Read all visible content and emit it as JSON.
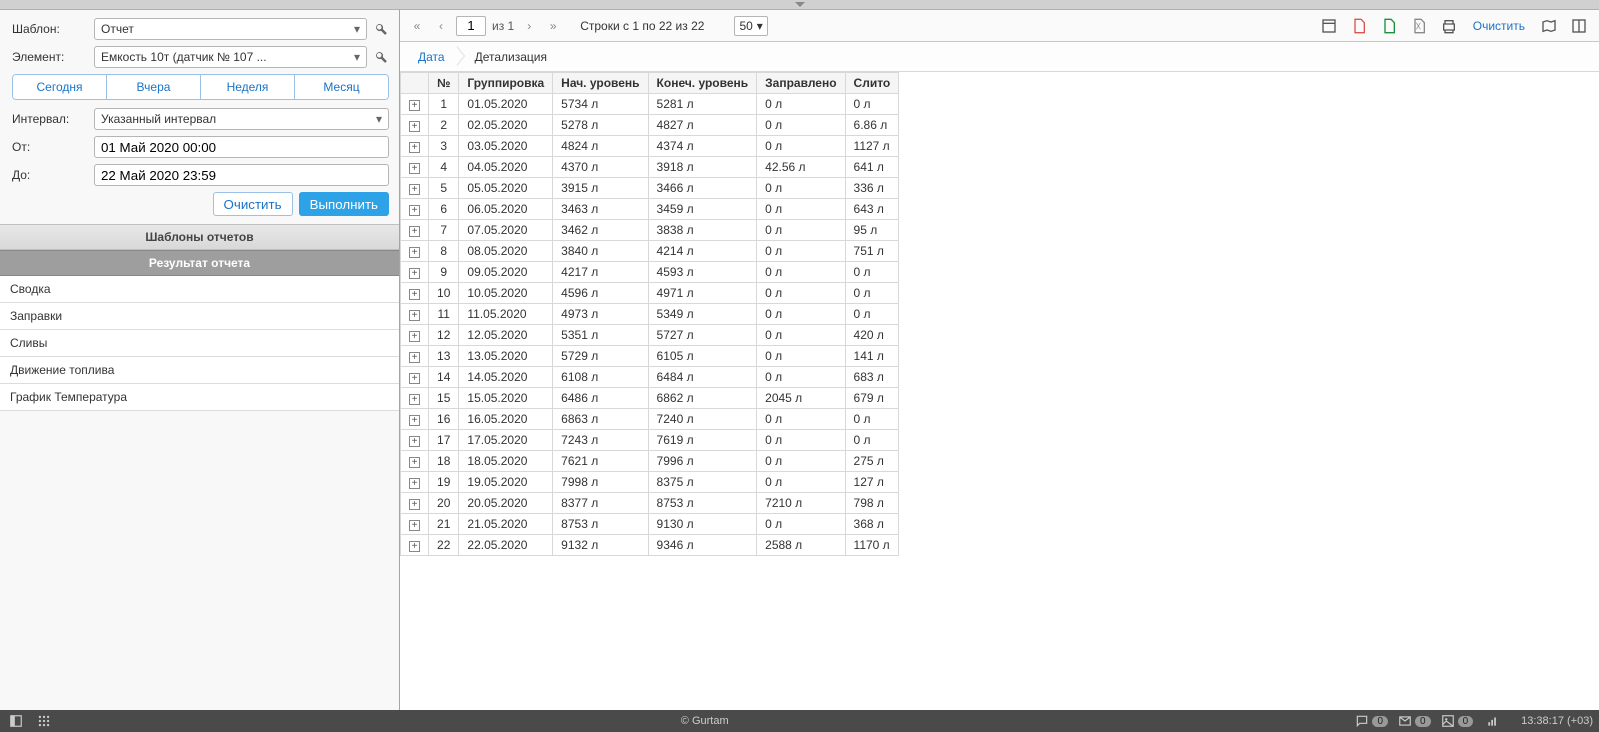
{
  "sidebar": {
    "labels": {
      "template": "Шаблон:",
      "element": "Элемент:",
      "interval": "Интервал:",
      "from": "От:",
      "to": "До:"
    },
    "template_value": "Отчет",
    "element_value": "Емкость 10т (датчик № 107 ...",
    "quick": {
      "today": "Сегодня",
      "yesterday": "Вчера",
      "week": "Неделя",
      "month": "Месяц"
    },
    "interval_value": "Указанный интервал",
    "from_value": "01 Май 2020 00:00",
    "to_value": "22 Май 2020 23:59",
    "buttons": {
      "clear": "Очистить",
      "execute": "Выполнить"
    },
    "sections": {
      "templates": "Шаблоны отчетов",
      "result": "Результат отчета"
    },
    "results": [
      "Сводка",
      "Заправки",
      "Сливы",
      "Движение топлива",
      "График Температура"
    ]
  },
  "toolbar": {
    "page": "1",
    "of_text": "из 1",
    "rows_text": "Строки с 1 по 22 из 22",
    "page_size": "50",
    "clear": "Очистить"
  },
  "breadcrumb": {
    "first": "Дата",
    "second": "Детализация"
  },
  "table": {
    "headers": [
      "№",
      "Группировка",
      "Нач. уровень",
      "Конеч. уровень",
      "Заправлено",
      "Слито"
    ],
    "rows": [
      {
        "n": "1",
        "g": "01.05.2020",
        "s": "5734 л",
        "e": "5281 л",
        "f": "0 л",
        "d": "0 л"
      },
      {
        "n": "2",
        "g": "02.05.2020",
        "s": "5278 л",
        "e": "4827 л",
        "f": "0 л",
        "d": "6.86 л"
      },
      {
        "n": "3",
        "g": "03.05.2020",
        "s": "4824 л",
        "e": "4374 л",
        "f": "0 л",
        "d": "1127 л"
      },
      {
        "n": "4",
        "g": "04.05.2020",
        "s": "4370 л",
        "e": "3918 л",
        "f": "42.56 л",
        "d": "641 л"
      },
      {
        "n": "5",
        "g": "05.05.2020",
        "s": "3915 л",
        "e": "3466 л",
        "f": "0 л",
        "d": "336 л"
      },
      {
        "n": "6",
        "g": "06.05.2020",
        "s": "3463 л",
        "e": "3459 л",
        "f": "0 л",
        "d": "643 л"
      },
      {
        "n": "7",
        "g": "07.05.2020",
        "s": "3462 л",
        "e": "3838 л",
        "f": "0 л",
        "d": "95 л"
      },
      {
        "n": "8",
        "g": "08.05.2020",
        "s": "3840 л",
        "e": "4214 л",
        "f": "0 л",
        "d": "751 л"
      },
      {
        "n": "9",
        "g": "09.05.2020",
        "s": "4217 л",
        "e": "4593 л",
        "f": "0 л",
        "d": "0 л"
      },
      {
        "n": "10",
        "g": "10.05.2020",
        "s": "4596 л",
        "e": "4971 л",
        "f": "0 л",
        "d": "0 л"
      },
      {
        "n": "11",
        "g": "11.05.2020",
        "s": "4973 л",
        "e": "5349 л",
        "f": "0 л",
        "d": "0 л"
      },
      {
        "n": "12",
        "g": "12.05.2020",
        "s": "5351 л",
        "e": "5727 л",
        "f": "0 л",
        "d": "420 л"
      },
      {
        "n": "13",
        "g": "13.05.2020",
        "s": "5729 л",
        "e": "6105 л",
        "f": "0 л",
        "d": "141 л"
      },
      {
        "n": "14",
        "g": "14.05.2020",
        "s": "6108 л",
        "e": "6484 л",
        "f": "0 л",
        "d": "683 л"
      },
      {
        "n": "15",
        "g": "15.05.2020",
        "s": "6486 л",
        "e": "6862 л",
        "f": "2045 л",
        "d": "679 л"
      },
      {
        "n": "16",
        "g": "16.05.2020",
        "s": "6863 л",
        "e": "7240 л",
        "f": "0 л",
        "d": "0 л"
      },
      {
        "n": "17",
        "g": "17.05.2020",
        "s": "7243 л",
        "e": "7619 л",
        "f": "0 л",
        "d": "0 л"
      },
      {
        "n": "18",
        "g": "18.05.2020",
        "s": "7621 л",
        "e": "7996 л",
        "f": "0 л",
        "d": "275 л"
      },
      {
        "n": "19",
        "g": "19.05.2020",
        "s": "7998 л",
        "e": "8375 л",
        "f": "0 л",
        "d": "127 л"
      },
      {
        "n": "20",
        "g": "20.05.2020",
        "s": "8377 л",
        "e": "8753 л",
        "f": "7210 л",
        "d": "798 л"
      },
      {
        "n": "21",
        "g": "21.05.2020",
        "s": "8753 л",
        "e": "9130 л",
        "f": "0 л",
        "d": "368 л"
      },
      {
        "n": "22",
        "g": "22.05.2020",
        "s": "9132 л",
        "e": "9346 л",
        "f": "2588 л",
        "d": "1170 л"
      }
    ]
  },
  "footer": {
    "copyright": "© Gurtam",
    "msg_count": "0",
    "mail_count": "0",
    "img_count": "0",
    "time": "13:38:17 (+03)"
  }
}
